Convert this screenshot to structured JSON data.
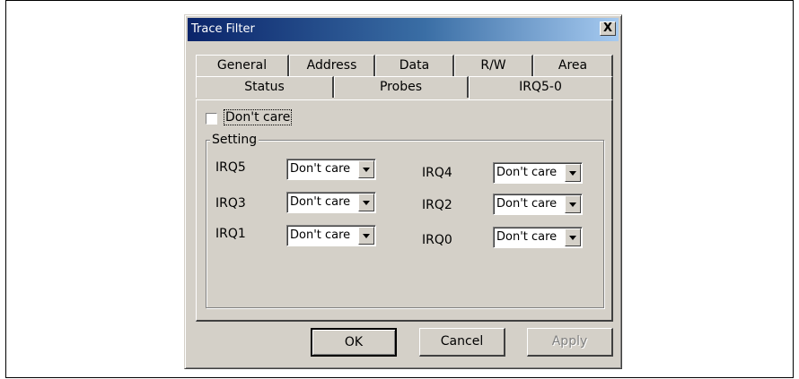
{
  "window": {
    "title": "Trace Filter",
    "close_symbol": "X"
  },
  "tabs_row1": [
    "General",
    "Address",
    "Data",
    "R/W",
    "Area"
  ],
  "tabs_row2": [
    "Status",
    "Probes",
    "IRQ5-0"
  ],
  "active_tab": "IRQ5-0",
  "dont_care_checkbox": {
    "label": "Don't care",
    "checked": false
  },
  "setting_group": {
    "title": "Setting",
    "irq_rows": [
      {
        "label": "IRQ5",
        "value": "Don't care"
      },
      {
        "label": "IRQ4",
        "value": "Don't care"
      },
      {
        "label": "IRQ3",
        "value": "Don't care"
      },
      {
        "label": "IRQ2",
        "value": "Don't care"
      },
      {
        "label": "IRQ1",
        "value": "Don't care"
      },
      {
        "label": "IRQ0",
        "value": "Don't care"
      }
    ]
  },
  "buttons": {
    "ok": "OK",
    "cancel": "Cancel",
    "apply": "Apply"
  }
}
